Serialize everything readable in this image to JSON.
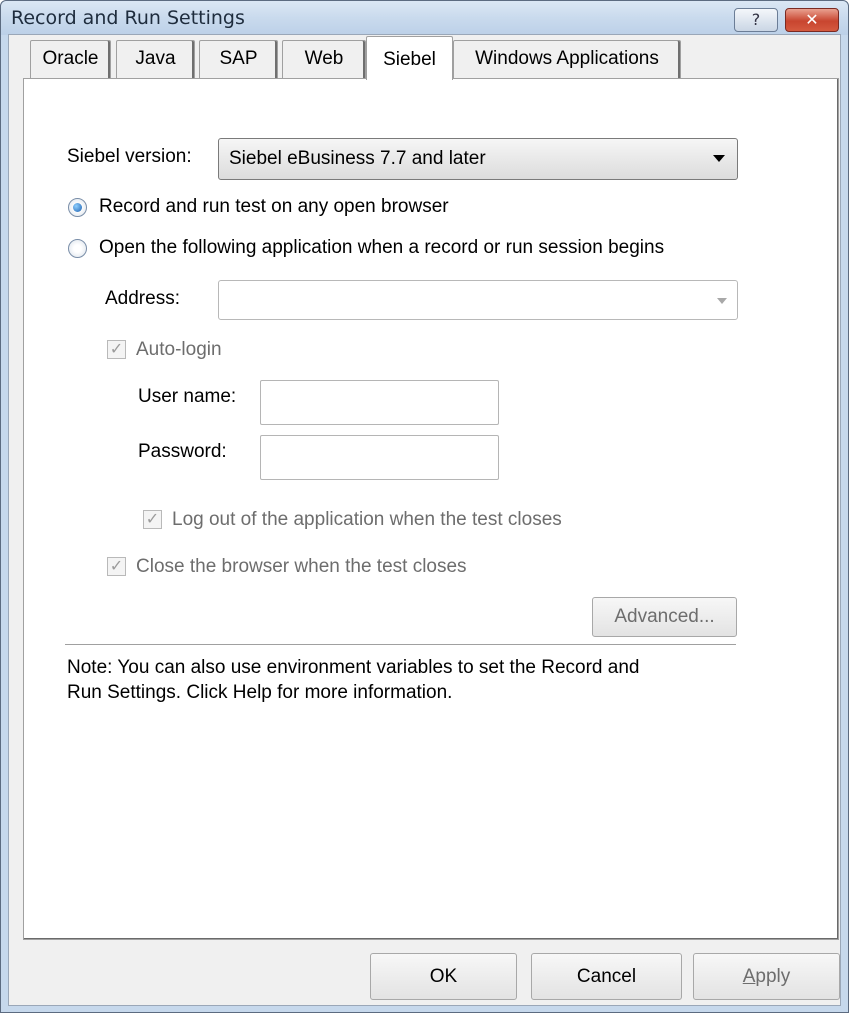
{
  "window": {
    "title": "Record and Run Settings",
    "help_label": "?",
    "close_label": "✕"
  },
  "tabs": [
    {
      "label": "Oracle",
      "active": false
    },
    {
      "label": "Java",
      "active": false
    },
    {
      "label": "SAP",
      "active": false
    },
    {
      "label": "Web",
      "active": false
    },
    {
      "label": "Siebel",
      "active": true
    },
    {
      "label": "Windows Applications",
      "active": false
    }
  ],
  "siebel": {
    "version_label": "Siebel version:",
    "version_value": "Siebel eBusiness 7.7 and later",
    "radio_any_browser": {
      "label": "Record and run test on any open browser",
      "checked": true
    },
    "radio_open_app": {
      "label": "Open the following application when a record or run session begins",
      "checked": false
    },
    "address_label": "Address:",
    "address_value": "",
    "auto_login": {
      "label": "Auto-login",
      "checked": true,
      "enabled": false
    },
    "user_name_label": "User name:",
    "user_name_value": "",
    "password_label": "Password:",
    "password_value": "",
    "logout": {
      "label": "Log out of the application when the test closes",
      "checked": true,
      "enabled": false
    },
    "close_browser": {
      "label": "Close the browser when the test closes",
      "checked": true,
      "enabled": false
    },
    "advanced_label": "Advanced...",
    "note_line1": "Note: You can also use environment variables to set the Record and",
    "note_line2": "Run Settings.  Click Help for more information."
  },
  "buttons": {
    "ok": "OK",
    "cancel": "Cancel",
    "apply_accel": "A",
    "apply_rest": "pply"
  },
  "checkmark": "✓"
}
